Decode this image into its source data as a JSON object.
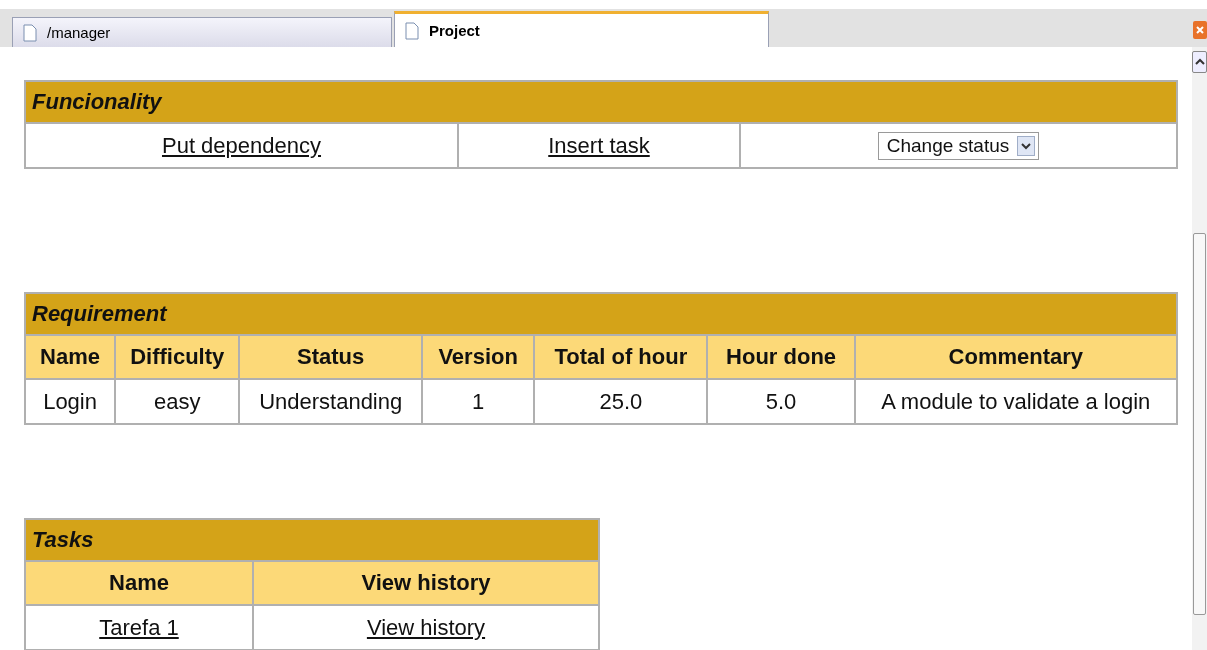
{
  "tabs": [
    {
      "label": "/manager",
      "selected": false
    },
    {
      "label": "Project",
      "selected": true
    }
  ],
  "funcionality": {
    "title": "Funcionality",
    "links": [
      "Put dependency",
      "Insert task"
    ],
    "status_select": {
      "value": "Change status"
    }
  },
  "requirement": {
    "title": "Requirement",
    "columns": [
      "Name",
      "Difficulty",
      "Status",
      "Version",
      "Total of hour",
      "Hour done",
      "Commentary"
    ],
    "rows": [
      [
        "Login",
        "easy",
        "Understanding",
        "1",
        "25.0",
        "5.0",
        "A module to validate a login"
      ]
    ]
  },
  "tasks": {
    "title": "Tasks",
    "columns": [
      "Name",
      "View history"
    ],
    "rows": [
      [
        {
          "text": "Tarefa 1",
          "kind": "link"
        },
        {
          "text": "View history",
          "kind": "link"
        }
      ]
    ]
  }
}
